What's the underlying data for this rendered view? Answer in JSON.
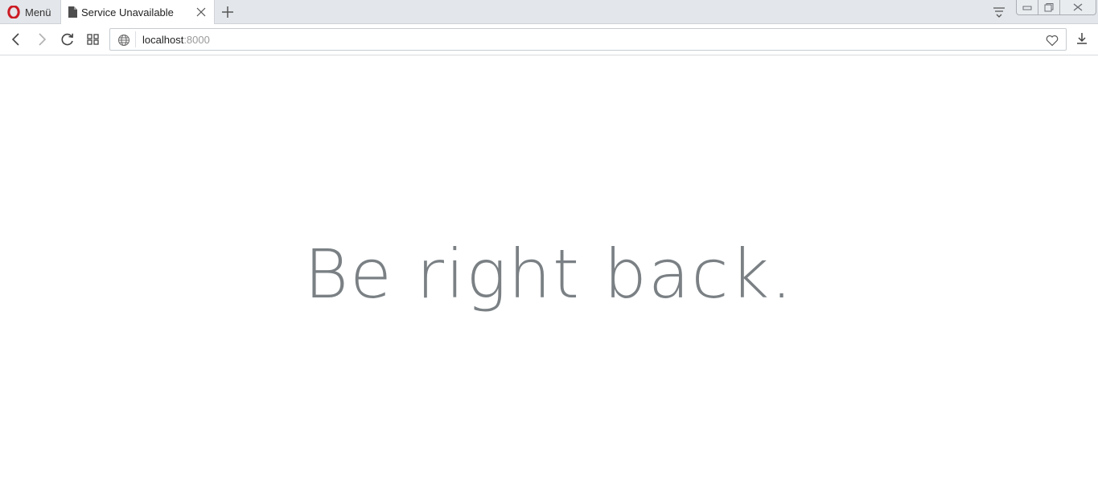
{
  "browser": {
    "menu_label": "Menü",
    "tab": {
      "title": "Service Unavailable"
    },
    "address": {
      "host": "localhost",
      "port": ":8000"
    }
  },
  "page": {
    "headline": "Be right back."
  },
  "colors": {
    "opera_red": "#cc1b24",
    "headline_gray": "#636b6f",
    "tabstrip_bg": "#e3e6ea"
  },
  "icons": {
    "menu": "opera-logo-icon",
    "tab": "file-icon",
    "tab_close": "close-icon",
    "new_tab": "plus-icon",
    "tabs_menu": "tab-menu-icon",
    "back": "chevron-left-icon",
    "forward": "chevron-right-icon",
    "reload": "reload-icon",
    "speed_dial": "grid-icon",
    "site_info": "globe-icon",
    "bookmark": "heart-icon",
    "download": "download-icon"
  }
}
